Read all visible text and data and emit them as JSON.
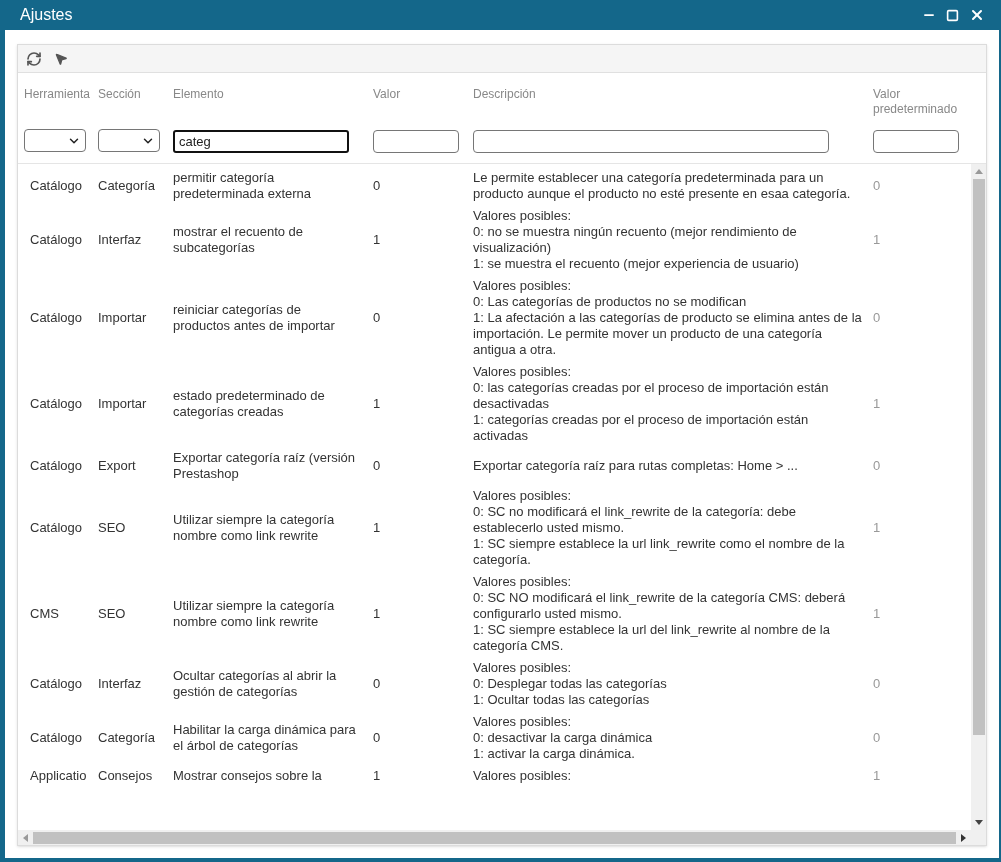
{
  "window": {
    "title": "Ajustes"
  },
  "columns": [
    {
      "label": "Herramienta",
      "filter": {
        "kind": "select"
      }
    },
    {
      "label": "Sección",
      "filter": {
        "kind": "select"
      }
    },
    {
      "label": "Elemento",
      "filter": {
        "kind": "text",
        "value": "categ",
        "focused": true
      }
    },
    {
      "label": "Valor",
      "filter": {
        "kind": "text",
        "focused": false
      }
    },
    {
      "label": "Descripción",
      "filter": {
        "kind": "text",
        "focused": false
      }
    },
    {
      "label": "Valor predeterminado",
      "filter": {
        "kind": "text",
        "focused": false
      }
    }
  ],
  "rows": [
    {
      "tool": "Catálogo",
      "section": "Categoría",
      "element": "permitir categoría predeterminada externa",
      "value": "0",
      "description": [
        "Le permite establecer una categoría predeterminada para un producto aunque el producto no esté presente en esaa categoría."
      ],
      "default": "0"
    },
    {
      "tool": "Catálogo",
      "section": "Interfaz",
      "element": "mostrar el recuento de subcategorías",
      "value": "1",
      "description": [
        "Valores posibles:",
        "0: no se muestra ningún recuento (mejor rendimiento de visualización)",
        "1: se muestra el recuento (mejor experiencia de usuario)"
      ],
      "default": "1"
    },
    {
      "tool": "Catálogo",
      "section": "Importar",
      "element": "reiniciar categorías de productos antes de importar",
      "value": "0",
      "description": [
        "Valores posibles:",
        "0: Las categorías de productos no se modifican",
        "1: La afectación a las categorías de producto se elimina antes de la importación. Le permite mover un producto de una categoría antigua a otra."
      ],
      "default": "0"
    },
    {
      "tool": "Catálogo",
      "section": "Importar",
      "element": "estado predeterminado de categorías creadas",
      "value": "1",
      "description": [
        "Valores posibles:",
        "0: las categorías creadas por el proceso de importación están desactivadas",
        "1: categorías creadas por el proceso de importación están activadas"
      ],
      "default": "1"
    },
    {
      "tool": "Catálogo",
      "section": "Export",
      "element": "Exportar categoría raíz (versión Prestashop",
      "value": "0",
      "description": [
        "Exportar categoría raíz para rutas completas: Home > ..."
      ],
      "default": "0"
    },
    {
      "tool": "Catálogo",
      "section": "SEO",
      "element": "Utilizar siempre la categoría nombre como link rewrite",
      "value": "1",
      "description": [
        "Valores posibles:",
        "0: SC no modificará el link_rewrite de la categoría: debe establecerlo usted mismo.",
        "1: SC siempre establece la url link_rewrite como el nombre de la categoría."
      ],
      "default": "1"
    },
    {
      "tool": "CMS",
      "section": "SEO",
      "element": "Utilizar siempre la categoría nombre como link rewrite",
      "value": "1",
      "description": [
        "Valores posibles:",
        "0: SC NO modificará el link_rewrite de la categoría CMS: deberá configurarlo usted mismo.",
        "1: SC siempre establece la url del link_rewrite al nombre de la categoría CMS."
      ],
      "default": "1"
    },
    {
      "tool": "Catálogo",
      "section": "Interfaz",
      "element": "Ocultar categorías al abrir la gestión de categorías",
      "value": "0",
      "description": [
        "Valores posibles:",
        "0: Desplegar todas las categorías",
        "1: Ocultar todas las categorías"
      ],
      "default": "0"
    },
    {
      "tool": "Catálogo",
      "section": "Categoría",
      "element": "Habilitar la carga dinámica para el árbol de categorías",
      "value": "0",
      "description": [
        "Valores posibles:",
        "0: desactivar la carga dinámica",
        "1: activar la carga dinámica."
      ],
      "default": "0"
    },
    {
      "tool": "Applicatio",
      "section": "Consejos",
      "element": "Mostrar consejos sobre la",
      "value": "1",
      "description": [
        "Valores posibles:"
      ],
      "default": "1"
    }
  ]
}
